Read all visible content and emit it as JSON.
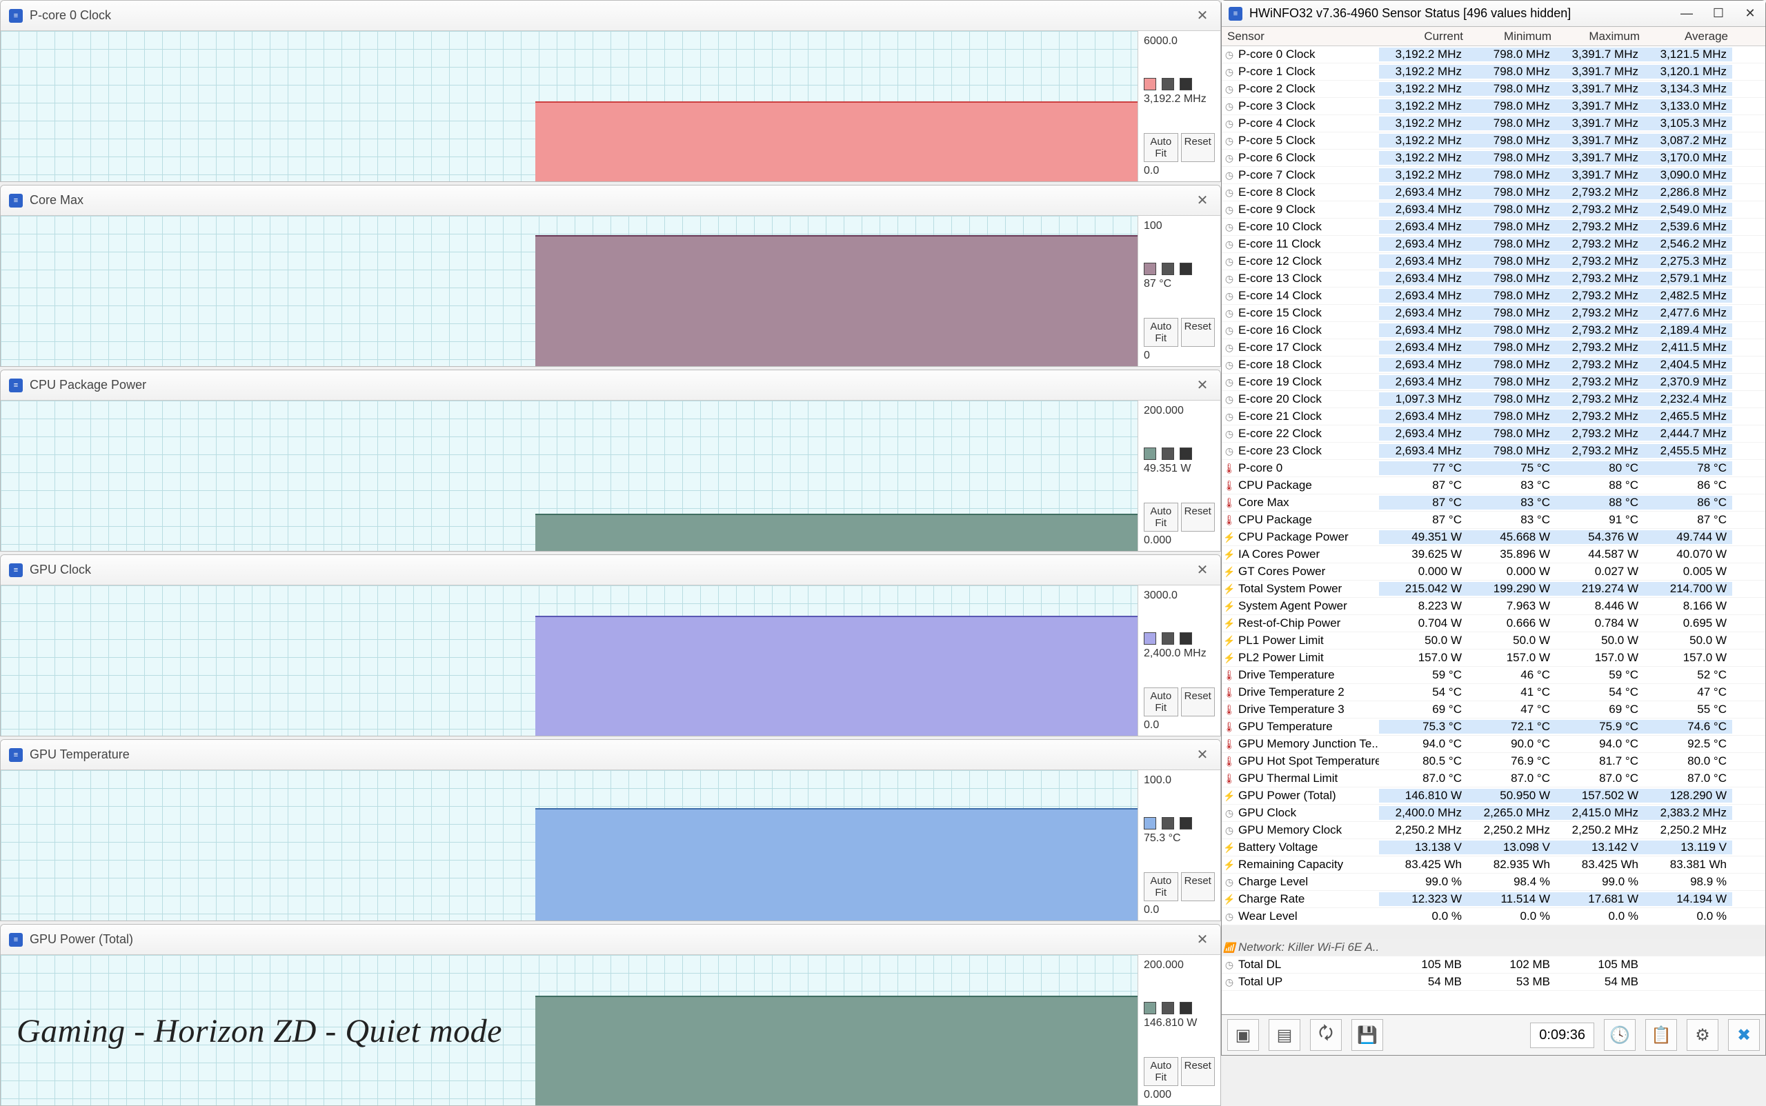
{
  "overlay": "Gaming - Horizon ZD - Quiet mode",
  "buttons": {
    "autofit": "Auto Fit",
    "reset": "Reset"
  },
  "graphs": [
    {
      "title": "P-core 0 Clock",
      "top": "6000.0",
      "val": "3,192.2 MHz",
      "bot": "0.0",
      "color": "#f29797",
      "edge": "#cc4040",
      "height": 0.53
    },
    {
      "title": "Core Max",
      "top": "100",
      "val": "87 °C",
      "bot": "0",
      "color": "#a7899a",
      "edge": "#6a3a57",
      "height": 0.87
    },
    {
      "title": "CPU Package Power",
      "top": "200.000",
      "val": "49.351 W",
      "bot": "0.000",
      "color": "#7d9e94",
      "edge": "#3f6e61",
      "height": 0.25
    },
    {
      "title": "GPU Clock",
      "top": "3000.0",
      "val": "2,400.0 MHz",
      "bot": "0.0",
      "color": "#a9a8e9",
      "edge": "#5a58b4",
      "height": 0.8
    },
    {
      "title": "GPU Temperature",
      "top": "100.0",
      "val": "75.3 °C",
      "bot": "0.0",
      "color": "#8fb4e8",
      "edge": "#3f6da9",
      "height": 0.75
    },
    {
      "title": "GPU Power (Total)",
      "top": "200.000",
      "val": "146.810 W",
      "bot": "0.000",
      "color": "#7d9e94",
      "edge": "#3f6e61",
      "height": 0.73
    }
  ],
  "window_title": "HWiNFO32 v7.36-4960 Sensor Status [496 values hidden]",
  "headers": {
    "sensor": "Sensor",
    "current": "Current",
    "minimum": "Minimum",
    "maximum": "Maximum",
    "average": "Average"
  },
  "rows": [
    {
      "ic": "clk",
      "hl": 1,
      "n": "P-core 0 Clock",
      "c": "3,192.2 MHz",
      "mn": "798.0 MHz",
      "mx": "3,391.7 MHz",
      "av": "3,121.5 MHz"
    },
    {
      "ic": "clk",
      "hl": 1,
      "n": "P-core 1 Clock",
      "c": "3,192.2 MHz",
      "mn": "798.0 MHz",
      "mx": "3,391.7 MHz",
      "av": "3,120.1 MHz"
    },
    {
      "ic": "clk",
      "hl": 1,
      "n": "P-core 2 Clock",
      "c": "3,192.2 MHz",
      "mn": "798.0 MHz",
      "mx": "3,391.7 MHz",
      "av": "3,134.3 MHz"
    },
    {
      "ic": "clk",
      "hl": 1,
      "n": "P-core 3 Clock",
      "c": "3,192.2 MHz",
      "mn": "798.0 MHz",
      "mx": "3,391.7 MHz",
      "av": "3,133.0 MHz"
    },
    {
      "ic": "clk",
      "hl": 1,
      "n": "P-core 4 Clock",
      "c": "3,192.2 MHz",
      "mn": "798.0 MHz",
      "mx": "3,391.7 MHz",
      "av": "3,105.3 MHz"
    },
    {
      "ic": "clk",
      "hl": 1,
      "n": "P-core 5 Clock",
      "c": "3,192.2 MHz",
      "mn": "798.0 MHz",
      "mx": "3,391.7 MHz",
      "av": "3,087.2 MHz"
    },
    {
      "ic": "clk",
      "hl": 1,
      "n": "P-core 6 Clock",
      "c": "3,192.2 MHz",
      "mn": "798.0 MHz",
      "mx": "3,391.7 MHz",
      "av": "3,170.0 MHz"
    },
    {
      "ic": "clk",
      "hl": 1,
      "n": "P-core 7 Clock",
      "c": "3,192.2 MHz",
      "mn": "798.0 MHz",
      "mx": "3,391.7 MHz",
      "av": "3,090.0 MHz"
    },
    {
      "ic": "clk",
      "hl": 1,
      "n": "E-core 8 Clock",
      "c": "2,693.4 MHz",
      "mn": "798.0 MHz",
      "mx": "2,793.2 MHz",
      "av": "2,286.8 MHz"
    },
    {
      "ic": "clk",
      "hl": 1,
      "n": "E-core 9 Clock",
      "c": "2,693.4 MHz",
      "mn": "798.0 MHz",
      "mx": "2,793.2 MHz",
      "av": "2,549.0 MHz"
    },
    {
      "ic": "clk",
      "hl": 1,
      "n": "E-core 10 Clock",
      "c": "2,693.4 MHz",
      "mn": "798.0 MHz",
      "mx": "2,793.2 MHz",
      "av": "2,539.6 MHz"
    },
    {
      "ic": "clk",
      "hl": 1,
      "n": "E-core 11 Clock",
      "c": "2,693.4 MHz",
      "mn": "798.0 MHz",
      "mx": "2,793.2 MHz",
      "av": "2,546.2 MHz"
    },
    {
      "ic": "clk",
      "hl": 1,
      "n": "E-core 12 Clock",
      "c": "2,693.4 MHz",
      "mn": "798.0 MHz",
      "mx": "2,793.2 MHz",
      "av": "2,275.3 MHz"
    },
    {
      "ic": "clk",
      "hl": 1,
      "n": "E-core 13 Clock",
      "c": "2,693.4 MHz",
      "mn": "798.0 MHz",
      "mx": "2,793.2 MHz",
      "av": "2,579.1 MHz"
    },
    {
      "ic": "clk",
      "hl": 1,
      "n": "E-core 14 Clock",
      "c": "2,693.4 MHz",
      "mn": "798.0 MHz",
      "mx": "2,793.2 MHz",
      "av": "2,482.5 MHz"
    },
    {
      "ic": "clk",
      "hl": 1,
      "n": "E-core 15 Clock",
      "c": "2,693.4 MHz",
      "mn": "798.0 MHz",
      "mx": "2,793.2 MHz",
      "av": "2,477.6 MHz"
    },
    {
      "ic": "clk",
      "hl": 1,
      "n": "E-core 16 Clock",
      "c": "2,693.4 MHz",
      "mn": "798.0 MHz",
      "mx": "2,793.2 MHz",
      "av": "2,189.4 MHz"
    },
    {
      "ic": "clk",
      "hl": 1,
      "n": "E-core 17 Clock",
      "c": "2,693.4 MHz",
      "mn": "798.0 MHz",
      "mx": "2,793.2 MHz",
      "av": "2,411.5 MHz"
    },
    {
      "ic": "clk",
      "hl": 1,
      "n": "E-core 18 Clock",
      "c": "2,693.4 MHz",
      "mn": "798.0 MHz",
      "mx": "2,793.2 MHz",
      "av": "2,404.5 MHz"
    },
    {
      "ic": "clk",
      "hl": 1,
      "n": "E-core 19 Clock",
      "c": "2,693.4 MHz",
      "mn": "798.0 MHz",
      "mx": "2,793.2 MHz",
      "av": "2,370.9 MHz"
    },
    {
      "ic": "clk",
      "hl": 1,
      "n": "E-core 20 Clock",
      "c": "1,097.3 MHz",
      "mn": "798.0 MHz",
      "mx": "2,793.2 MHz",
      "av": "2,232.4 MHz"
    },
    {
      "ic": "clk",
      "hl": 1,
      "n": "E-core 21 Clock",
      "c": "2,693.4 MHz",
      "mn": "798.0 MHz",
      "mx": "2,793.2 MHz",
      "av": "2,465.5 MHz"
    },
    {
      "ic": "clk",
      "hl": 1,
      "n": "E-core 22 Clock",
      "c": "2,693.4 MHz",
      "mn": "798.0 MHz",
      "mx": "2,793.2 MHz",
      "av": "2,444.7 MHz"
    },
    {
      "ic": "clk",
      "hl": 1,
      "n": "E-core 23 Clock",
      "c": "2,693.4 MHz",
      "mn": "798.0 MHz",
      "mx": "2,793.2 MHz",
      "av": "2,455.5 MHz"
    },
    {
      "ic": "temp",
      "hl": 1,
      "n": "P-core 0",
      "c": "77 °C",
      "mn": "75 °C",
      "mx": "80 °C",
      "av": "78 °C"
    },
    {
      "ic": "temp",
      "n": "CPU Package",
      "c": "87 °C",
      "mn": "83 °C",
      "mx": "88 °C",
      "av": "86 °C"
    },
    {
      "ic": "temp",
      "hl": 1,
      "n": "Core Max",
      "c": "87 °C",
      "mn": "83 °C",
      "mx": "88 °C",
      "av": "86 °C"
    },
    {
      "ic": "temp",
      "n": "CPU Package",
      "c": "87 °C",
      "mn": "83 °C",
      "mx": "91 °C",
      "av": "87 °C"
    },
    {
      "ic": "pow",
      "hl": 1,
      "n": "CPU Package Power",
      "c": "49.351 W",
      "mn": "45.668 W",
      "mx": "54.376 W",
      "av": "49.744 W"
    },
    {
      "ic": "pow",
      "n": "IA Cores Power",
      "c": "39.625 W",
      "mn": "35.896 W",
      "mx": "44.587 W",
      "av": "40.070 W"
    },
    {
      "ic": "pow",
      "n": "GT Cores Power",
      "c": "0.000 W",
      "mn": "0.000 W",
      "mx": "0.027 W",
      "av": "0.005 W"
    },
    {
      "ic": "pow",
      "hl": 1,
      "n": "Total System Power",
      "c": "215.042 W",
      "mn": "199.290 W",
      "mx": "219.274 W",
      "av": "214.700 W"
    },
    {
      "ic": "pow",
      "n": "System Agent Power",
      "c": "8.223 W",
      "mn": "7.963 W",
      "mx": "8.446 W",
      "av": "8.166 W"
    },
    {
      "ic": "pow",
      "n": "Rest-of-Chip Power",
      "c": "0.704 W",
      "mn": "0.666 W",
      "mx": "0.784 W",
      "av": "0.695 W"
    },
    {
      "ic": "pow",
      "n": "PL1 Power Limit",
      "c": "50.0 W",
      "mn": "50.0 W",
      "mx": "50.0 W",
      "av": "50.0 W"
    },
    {
      "ic": "pow",
      "n": "PL2 Power Limit",
      "c": "157.0 W",
      "mn": "157.0 W",
      "mx": "157.0 W",
      "av": "157.0 W"
    },
    {
      "ic": "temp",
      "n": "Drive Temperature",
      "c": "59 °C",
      "mn": "46 °C",
      "mx": "59 °C",
      "av": "52 °C"
    },
    {
      "ic": "temp",
      "n": "Drive Temperature 2",
      "c": "54 °C",
      "mn": "41 °C",
      "mx": "54 °C",
      "av": "47 °C"
    },
    {
      "ic": "temp",
      "n": "Drive Temperature 3",
      "c": "69 °C",
      "mn": "47 °C",
      "mx": "69 °C",
      "av": "55 °C"
    },
    {
      "ic": "temp",
      "hl": 1,
      "n": "GPU Temperature",
      "c": "75.3 °C",
      "mn": "72.1 °C",
      "mx": "75.9 °C",
      "av": "74.6 °C"
    },
    {
      "ic": "temp",
      "n": "GPU Memory Junction Te...",
      "c": "94.0 °C",
      "mn": "90.0 °C",
      "mx": "94.0 °C",
      "av": "92.5 °C"
    },
    {
      "ic": "temp",
      "n": "GPU Hot Spot Temperature",
      "c": "80.5 °C",
      "mn": "76.9 °C",
      "mx": "81.7 °C",
      "av": "80.0 °C"
    },
    {
      "ic": "temp",
      "n": "GPU Thermal Limit",
      "c": "87.0 °C",
      "mn": "87.0 °C",
      "mx": "87.0 °C",
      "av": "87.0 °C"
    },
    {
      "ic": "pow",
      "hl": 1,
      "n": "GPU Power (Total)",
      "c": "146.810 W",
      "mn": "50.950 W",
      "mx": "157.502 W",
      "av": "128.290 W"
    },
    {
      "ic": "clk",
      "hl": 1,
      "n": "GPU Clock",
      "c": "2,400.0 MHz",
      "mn": "2,265.0 MHz",
      "mx": "2,415.0 MHz",
      "av": "2,383.2 MHz"
    },
    {
      "ic": "clk",
      "n": "GPU Memory Clock",
      "c": "2,250.2 MHz",
      "mn": "2,250.2 MHz",
      "mx": "2,250.2 MHz",
      "av": "2,250.2 MHz"
    },
    {
      "ic": "pow",
      "hl": 1,
      "n": "Battery Voltage",
      "c": "13.138 V",
      "mn": "13.098 V",
      "mx": "13.142 V",
      "av": "13.119 V"
    },
    {
      "ic": "pow",
      "n": "Remaining Capacity",
      "c": "83.425 Wh",
      "mn": "82.935 Wh",
      "mx": "83.425 Wh",
      "av": "83.381 Wh"
    },
    {
      "ic": "clk",
      "n": "Charge Level",
      "c": "99.0 %",
      "mn": "98.4 %",
      "mx": "99.0 %",
      "av": "98.9 %"
    },
    {
      "ic": "pow",
      "hl": 1,
      "n": "Charge Rate",
      "c": "12.323 W",
      "mn": "11.514 W",
      "mx": "17.681 W",
      "av": "14.194 W"
    },
    {
      "ic": "clk",
      "n": "Wear Level",
      "c": "0.0 %",
      "mn": "0.0 %",
      "mx": "0.0 %",
      "av": "0.0 %"
    }
  ],
  "group_label": "Network: Killer Wi-Fi 6E A...",
  "net_rows": [
    {
      "ic": "clk",
      "n": "Total DL",
      "c": "105 MB",
      "mn": "102 MB",
      "mx": "105 MB",
      "av": ""
    },
    {
      "ic": "clk",
      "n": "Total UP",
      "c": "54 MB",
      "mn": "53 MB",
      "mx": "54 MB",
      "av": ""
    }
  ],
  "timer": "0:09:36",
  "chart_data": [
    {
      "type": "area",
      "title": "P-core 0 Clock",
      "ylim": [
        0,
        6000
      ],
      "y_unit": "MHz",
      "current": 3192.2,
      "series": [
        {
          "name": "P-core 0 Clock",
          "approx_value": 3192.2,
          "fill": "#f29797"
        }
      ]
    },
    {
      "type": "area",
      "title": "Core Max",
      "ylim": [
        0,
        100
      ],
      "y_unit": "°C",
      "current": 87,
      "series": [
        {
          "name": "Core Max",
          "approx_value": 87,
          "fill": "#a7899a"
        }
      ]
    },
    {
      "type": "area",
      "title": "CPU Package Power",
      "ylim": [
        0,
        200
      ],
      "y_unit": "W",
      "current": 49.351,
      "series": [
        {
          "name": "CPU Package Power",
          "approx_value": 49.351,
          "fill": "#7d9e94"
        }
      ]
    },
    {
      "type": "area",
      "title": "GPU Clock",
      "ylim": [
        0,
        3000
      ],
      "y_unit": "MHz",
      "current": 2400.0,
      "series": [
        {
          "name": "GPU Clock",
          "approx_value": 2400.0,
          "fill": "#a9a8e9"
        }
      ]
    },
    {
      "type": "area",
      "title": "GPU Temperature",
      "ylim": [
        0,
        100
      ],
      "y_unit": "°C",
      "current": 75.3,
      "series": [
        {
          "name": "GPU Temperature",
          "approx_value": 75.3,
          "fill": "#8fb4e8"
        }
      ]
    },
    {
      "type": "area",
      "title": "GPU Power (Total)",
      "ylim": [
        0,
        200
      ],
      "y_unit": "W",
      "current": 146.81,
      "series": [
        {
          "name": "GPU Power (Total)",
          "approx_value": 146.81,
          "fill": "#7d9e94"
        }
      ]
    }
  ]
}
